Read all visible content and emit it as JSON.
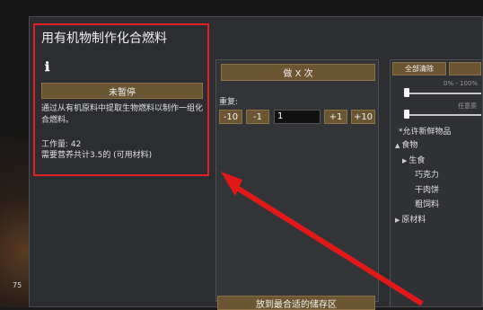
{
  "recipe": {
    "title": "用有机物制作化合燃料",
    "info_icon": "info-icon",
    "suspend_button": "未暂停",
    "description": "通过从有机原料中提取生物燃料以制作一组化合燃料。",
    "work_amount": "工作量: 42",
    "nutrition_required": "需要营养共计3.5的 (可用材料)"
  },
  "bill": {
    "mode_button": "做 X 次",
    "repeat_label": "重复:",
    "dec10": "-10",
    "dec1": "-1",
    "count_value": "1",
    "inc1": "+1",
    "inc10": "+10",
    "store_button": "放到最合适的储存区"
  },
  "ingredients": {
    "clear_all": "全部清除",
    "tab2": "",
    "percent_range": "0% - 100%",
    "quality_range": "任意质",
    "allow_fresh": "*允许新鲜物品",
    "tree": [
      {
        "label": "食物",
        "expander": "▲",
        "indent": 0
      },
      {
        "label": "生食",
        "expander": "▶",
        "indent": 1
      },
      {
        "label": "巧克力",
        "expander": "",
        "indent": 2
      },
      {
        "label": "干肉饼",
        "expander": "",
        "indent": 2
      },
      {
        "label": "粗饲料",
        "expander": "",
        "indent": 2
      },
      {
        "label": "原材料",
        "expander": "▶",
        "indent": 0
      }
    ]
  },
  "background": {
    "counter_text": "75"
  },
  "colors": {
    "highlight": "#e02020",
    "button": "#6b5532",
    "panel": "#2b2d31"
  }
}
